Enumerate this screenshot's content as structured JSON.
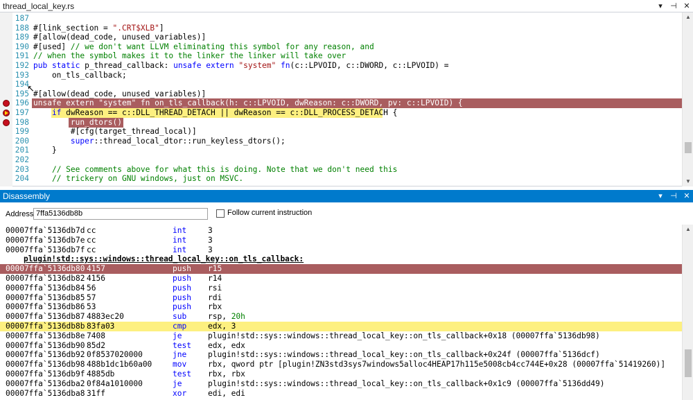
{
  "editor": {
    "tab_title": "thread_local_key.rs",
    "lines": [
      {
        "num": "187",
        "parts": []
      },
      {
        "num": "188",
        "parts": [
          {
            "c": "t",
            "s": "#[link_section = "
          },
          {
            "c": "st",
            "s": "\".CRT$XLB\""
          },
          {
            "c": "t",
            "s": "]"
          }
        ]
      },
      {
        "num": "189",
        "parts": [
          {
            "c": "t",
            "s": "#[allow(dead_code, unused_variables)]"
          }
        ]
      },
      {
        "num": "190",
        "parts": [
          {
            "c": "t",
            "s": "#[used] "
          },
          {
            "c": "cm",
            "s": "// we don't want LLVM eliminating this symbol for any reason, and"
          }
        ]
      },
      {
        "num": "191",
        "parts": [
          {
            "c": "cm",
            "s": "// when the symbol makes it to the linker the linker will take over"
          }
        ]
      },
      {
        "num": "192",
        "parts": [
          {
            "c": "kw",
            "s": "pub static "
          },
          {
            "c": "t",
            "s": "p_thread_callback: "
          },
          {
            "c": "kw",
            "s": "unsafe extern "
          },
          {
            "c": "st",
            "s": "\"system\""
          },
          {
            "c": "t",
            "s": " "
          },
          {
            "c": "kw",
            "s": "fn"
          },
          {
            "c": "t",
            "s": "(c::LPVOID, c::DWORD, c::LPVOID) ="
          }
        ]
      },
      {
        "num": "193",
        "parts": [
          {
            "c": "t",
            "s": "    on_tls_callback;"
          }
        ]
      },
      {
        "num": "194",
        "parts": []
      },
      {
        "num": "195",
        "parts": [
          {
            "c": "t",
            "s": "#[allow(dead_code, unused_variables)]"
          }
        ]
      },
      {
        "num": "196",
        "parts": [
          {
            "c": "t",
            "s": "unsafe extern \"system\" fn on_tls_callback(h: c::LPVOID, dwReason: c::DWORD, pv: c::LPVOID) {"
          }
        ]
      },
      {
        "num": "197",
        "parts": [
          {
            "c": "t",
            "s": "    "
          },
          {
            "c": "kw",
            "s": "if"
          },
          {
            "c": "t",
            "s": " dwReason == c::DLL_THREAD_DETACH || dwReason == c::DLL_PROCESS_DETACH {"
          }
        ]
      },
      {
        "num": "198",
        "parts": [
          {
            "c": "t",
            "s": "        run_dtors();"
          }
        ]
      },
      {
        "num": "199",
        "parts": [
          {
            "c": "t",
            "s": "        #[cfg(target_thread_local)]"
          }
        ]
      },
      {
        "num": "200",
        "parts": [
          {
            "c": "t",
            "s": "        "
          },
          {
            "c": "kw",
            "s": "super"
          },
          {
            "c": "t",
            "s": "::thread_local_dtor::run_keyless_dtors();"
          }
        ]
      },
      {
        "num": "201",
        "parts": [
          {
            "c": "t",
            "s": "    }"
          }
        ]
      },
      {
        "num": "202",
        "parts": []
      },
      {
        "num": "203",
        "parts": [
          {
            "c": "t",
            "s": "    "
          },
          {
            "c": "cm",
            "s": "// See comments above for what this is doing. Note that we don't need this"
          }
        ]
      },
      {
        "num": "204",
        "parts": [
          {
            "c": "t",
            "s": "    "
          },
          {
            "c": "cm",
            "s": "// trickery on GNU windows, just on MSVC."
          }
        ]
      }
    ],
    "breakpoint_lines": [
      "196",
      "197",
      "198"
    ],
    "current_line": "197"
  },
  "disassembly": {
    "title": "Disassembly",
    "address_label": "Address:",
    "address_value": "7ffa5136db8b",
    "follow_label": "Follow current instruction",
    "lines": [
      {
        "addr": "00007ffa`5136db7d",
        "bytes": "cc",
        "mn": "int",
        "op": "3"
      },
      {
        "addr": "00007ffa`5136db7e",
        "bytes": "cc",
        "mn": "int",
        "op": "3"
      },
      {
        "addr": "00007ffa`5136db7f",
        "bytes": "cc",
        "mn": "int",
        "op": "3"
      },
      {
        "symbol": "plugin!std::sys::windows::thread_local_key::on_tls_callback:"
      },
      {
        "addr": "00007ffa`5136db80",
        "bytes": "4157",
        "mn": "push",
        "op": "r15",
        "state": "bp"
      },
      {
        "addr": "00007ffa`5136db82",
        "bytes": "4156",
        "mn": "push",
        "op": "r14"
      },
      {
        "addr": "00007ffa`5136db84",
        "bytes": "56",
        "mn": "push",
        "op": "rsi"
      },
      {
        "addr": "00007ffa`5136db85",
        "bytes": "57",
        "mn": "push",
        "op": "rdi"
      },
      {
        "addr": "00007ffa`5136db86",
        "bytes": "53",
        "mn": "push",
        "op": "rbx"
      },
      {
        "addr": "00007ffa`5136db87",
        "bytes": "4883ec20",
        "mn": "sub",
        "op": "rsp, ",
        "num": "20h"
      },
      {
        "addr": "00007ffa`5136db8b",
        "bytes": "83fa03",
        "mn": "cmp",
        "op": "edx, 3",
        "state": "cur"
      },
      {
        "addr": "00007ffa`5136db8e",
        "bytes": "7408",
        "mn": "je",
        "op": "plugin!std::sys::windows::thread_local_key::on_tls_callback+0x18 (00007ffa`5136db98)"
      },
      {
        "addr": "00007ffa`5136db90",
        "bytes": "85d2",
        "mn": "test",
        "op": "edx, edx"
      },
      {
        "addr": "00007ffa`5136db92",
        "bytes": "0f8537020000",
        "mn": "jne",
        "op": "plugin!std::sys::windows::thread_local_key::on_tls_callback+0x24f (00007ffa`5136dcf)"
      },
      {
        "addr": "00007ffa`5136db98",
        "bytes": "488b1dc1b60a00",
        "mn": "mov",
        "op": "rbx, qword ptr [plugin!ZN3std3sys7windows5alloc4HEAP17h115e5008cb4cc744E+0x28 (00007ffa`51419260)]"
      },
      {
        "addr": "00007ffa`5136db9f",
        "bytes": "4885db",
        "mn": "test",
        "op": "rbx, rbx"
      },
      {
        "addr": "00007ffa`5136dba2",
        "bytes": "0f84a1010000",
        "mn": "je",
        "op": "plugin!std::sys::windows::thread_local_key::on_tls_callback+0x1c9 (00007ffa`5136dd49)"
      },
      {
        "addr": "00007ffa`5136dba8",
        "bytes": "31ff",
        "mn": "xor",
        "op": "edi, edi"
      }
    ]
  },
  "colors": {
    "breakpoint_bg": "#a95d5f",
    "current_bg": "#fdf080",
    "title_accent": "#007acc"
  },
  "icons": [
    "pin-icon",
    "close-icon",
    "dropdown-icon",
    "breakpoint-icon",
    "current-instruction-icon",
    "mouse-cursor-icon"
  ]
}
